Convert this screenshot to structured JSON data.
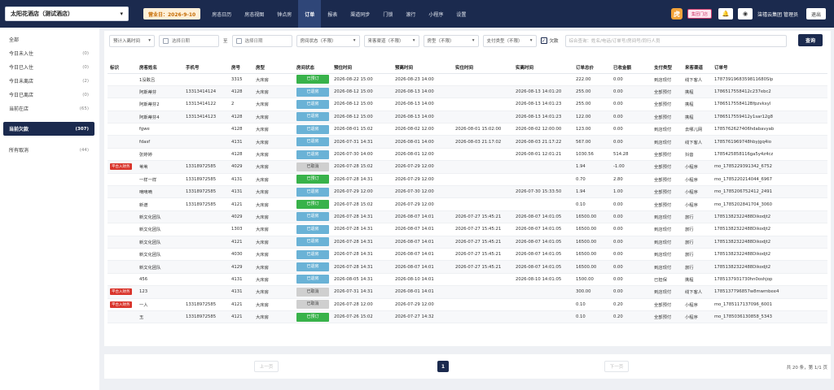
{
  "header": {
    "hotel": "太阳花酒店（测试酒店）",
    "date_label": "营业日：2026-9-10",
    "nav": [
      "房态日历",
      "房态视图",
      "钟点房",
      "订单",
      "报表",
      "渠道同步",
      "门锁",
      "滚行",
      "小程序",
      "设置"
    ],
    "active_nav": "订单",
    "group_button": "集团门店",
    "company": "柒禧云集团 管理员",
    "logout": "退出"
  },
  "sidebar": {
    "items": [
      {
        "label": "全部",
        "count": ""
      },
      {
        "label": "今日未入住",
        "count": "(0)"
      },
      {
        "label": "今日已入住",
        "count": "(0)"
      },
      {
        "label": "今日未离店",
        "count": "(2)"
      },
      {
        "label": "今日已离店",
        "count": "(0)"
      },
      {
        "label": "当前在店",
        "count": "(65)"
      },
      {
        "label": "当前欠款",
        "count": "(307)"
      },
      {
        "label": "所有取消",
        "count": "(44)"
      }
    ],
    "active_index": 6
  },
  "filters": {
    "time_type": "预计入离时间",
    "start_placeholder": "选择日期",
    "separator": "至",
    "end_placeholder": "选择日期",
    "room_status": "房间状态（不限）",
    "channel": "来客渠道（不限）",
    "room_type": "房型（不限）",
    "payment": "支付类型（不限）",
    "arrears_label": "欠款",
    "search_placeholder": "综合查询：姓名/电话/订单号/房间号/同行人员",
    "query_button": "查询"
  },
  "table": {
    "headers": [
      "标识",
      "房客姓名",
      "手机号",
      "房号",
      "房型",
      "房间状态",
      "预住时间",
      "预离时间",
      "实住时间",
      "实离时间",
      "订单总价",
      "已收金额",
      "支付类型",
      "来客渠道",
      "订单号"
    ],
    "rows": [
      [
        "",
        "1没敢吕",
        "",
        "3315",
        "大床房",
        "已预订",
        "2026-08-22 15:00",
        "2026-08-23 14:00",
        "",
        "",
        "222.00",
        "0.00",
        "到店现付",
        "线下客人",
        "1787391968359811680Slp"
      ],
      [
        "",
        "阿斯蒂芬",
        "13313414124",
        "4128",
        "大床房",
        "已退房",
        "2026-08-12 15:00",
        "2026-08-13 14:00",
        "",
        "2026-08-13 14:01:20",
        "255.00",
        "0.00",
        "全部预付",
        "携程",
        "1786517558412c237ebc2"
      ],
      [
        "",
        "阿斯蒂芬2",
        "13313414122",
        "2",
        "大床房",
        "已退房",
        "2026-08-12 15:00",
        "2026-08-13 14:00",
        "",
        "2026-08-13 14:01:23",
        "255.00",
        "0.00",
        "全部预付",
        "携程",
        "1786517558412Bfpzvkxyl"
      ],
      [
        "",
        "阿斯蒂芬4",
        "13313414123",
        "4128",
        "大床房",
        "已退房",
        "2026-08-12 15:00",
        "2026-08-13 14:00",
        "",
        "2026-08-13 14:01:23",
        "122.00",
        "0.00",
        "全部预付",
        "携程",
        "1786517559412y1sar12g8"
      ],
      [
        "",
        "fgwe",
        "",
        "4128",
        "大床房",
        "已退房",
        "2026-08-01 15:02",
        "2026-08-02 12:00",
        "2026-08-01 15:02:00",
        "2026-08-02 12:00:00",
        "123.00",
        "0.00",
        "到店现付",
        "去哪儿网",
        "1785762627406hdabavyab"
      ],
      [
        "",
        "fdasf",
        "",
        "4131",
        "大床房",
        "已退房",
        "2026-07-31 14:31",
        "2026-08-01 14:00",
        "2026-08-03 21:17:02",
        "2026-08-03 21:17:22",
        "567.00",
        "0.00",
        "到店现付",
        "线下客人",
        "1785761969748hbyjgq4io"
      ],
      [
        "",
        "张婷婷",
        "",
        "4128",
        "大床房",
        "已退房",
        "2026-07-30 14:00",
        "2026-08-01 12:00",
        "",
        "2026-08-01 12:01:21",
        "1030.56",
        "514.28",
        "全部预付",
        "抖音",
        "1785425858116ga5y4z4cz"
      ],
      [
        "平台入财务",
        "苇苇",
        "13318972585",
        "4029",
        "大床房",
        "已取消",
        "2026-07-28 15:02",
        "2026-07-29 12:00",
        "",
        "",
        "1.94",
        "-1.00",
        "全部预付",
        "小程序",
        "mo_1785229391342_6752"
      ],
      [
        "",
        "一样一样",
        "13318972585",
        "4131",
        "大床房",
        "已预订",
        "2026-07-28 14:31",
        "2026-07-29 12:00",
        "",
        "",
        "0.70",
        "2.80",
        "全部预付",
        "小程序",
        "mo_1785220214044_6967"
      ],
      [
        "",
        "嘀嘀嘀",
        "13318972585",
        "4131",
        "大床房",
        "已退房",
        "2026-07-29 12:00",
        "2026-07-30 12:00",
        "",
        "2026-07-30 15:33:50",
        "1.94",
        "1.00",
        "全部预付",
        "小程序",
        "mo_1785206752412_2491"
      ],
      [
        "",
        "新谱",
        "13318972585",
        "4121",
        "大床房",
        "已预订",
        "2026-07-28 15:02",
        "2026-07-29 12:00",
        "",
        "",
        "0.10",
        "0.00",
        "全部预付",
        "小程序",
        "mo_1785202841704_3060"
      ],
      [
        "",
        "新文化团队",
        "",
        "4029",
        "大床房",
        "已退房",
        "2026-07-28 14:31",
        "2026-08-07 14:01",
        "2026-07-27 15:45:21",
        "2026-08-07 14:01:05",
        "16500.00",
        "0.00",
        "到店现付",
        "旅行",
        "17851382322488Dikodjt2"
      ],
      [
        "",
        "新文化团队",
        "",
        "1303",
        "大床房",
        "已退房",
        "2026-07-28 14:31",
        "2026-08-07 14:01",
        "2026-07-27 15:45:21",
        "2026-08-07 14:01:05",
        "16500.00",
        "0.00",
        "到店现付",
        "旅行",
        "17851382322488Dikodjt2"
      ],
      [
        "",
        "新文化团队",
        "",
        "4121",
        "大床房",
        "已退房",
        "2026-07-28 14:31",
        "2026-08-07 14:01",
        "2026-07-27 15:45:21",
        "2026-08-07 14:01:05",
        "16500.00",
        "0.00",
        "到店现付",
        "旅行",
        "17851382322488Dikodjt2"
      ],
      [
        "",
        "新文化团队",
        "",
        "4030",
        "大床房",
        "已退房",
        "2026-07-28 14:31",
        "2026-08-07 14:01",
        "2026-07-27 15:45:21",
        "2026-08-07 14:01:05",
        "16500.00",
        "0.00",
        "到店现付",
        "旅行",
        "17851382322488Dikodjt2"
      ],
      [
        "",
        "新文化团队",
        "",
        "4129",
        "大床房",
        "已退房",
        "2026-07-28 14:31",
        "2026-08-07 14:01",
        "2026-07-27 15:45:21",
        "2026-08-07 14:01:05",
        "16500.00",
        "0.00",
        "到店现付",
        "旅行",
        "17851382322488Dikodjt2"
      ],
      [
        "",
        "456",
        "",
        "4131",
        "大床房",
        "已退房",
        "2026-08-05 14:31",
        "2026-08-10 14:01",
        "",
        "2026-08-10 14:01:05",
        "1500.00",
        "0.00",
        "已担保",
        "携程",
        "1785137931730hn0oshjop"
      ],
      [
        "平台入财务",
        "123",
        "",
        "4131",
        "大床房",
        "已取消",
        "2026-07-31 14:31",
        "2026-08-01 14:01",
        "",
        "",
        "300.00",
        "0.00",
        "到店现付",
        "线下客人",
        "1785137796857w8mwmbee4"
      ],
      [
        "平台入财务",
        "一人",
        "13318972585",
        "4121",
        "大床房",
        "已取消",
        "2026-07-28 12:00",
        "2026-07-29 12:00",
        "",
        "",
        "0.10",
        "0.20",
        "全部预付",
        "小程序",
        "mo_1785117137096_6001"
      ],
      [
        "",
        "玉",
        "13318972585",
        "4121",
        "大床房",
        "已预订",
        "2026-07-26 15:02",
        "2026-07-27 14:32",
        "",
        "",
        "0.10",
        "0.20",
        "全部预付",
        "小程序",
        "mo_1785036130858_5343"
      ]
    ]
  },
  "pagination": {
    "prev": "上一页",
    "current": "1",
    "next": "下一页",
    "info": "共 20 条，第 1/1 页"
  },
  "colors": {
    "navy": "#1b2a4e",
    "reserved": "#38b24a",
    "checked_out": "#6ab2d6",
    "cancelled": "#cfcfcf",
    "flag": "#d9342b"
  }
}
